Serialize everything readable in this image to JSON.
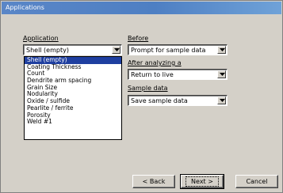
{
  "window": {
    "title": "Applications"
  },
  "application": {
    "label": "Application",
    "selected": "Shell (empty)",
    "options": [
      "Shell (empty)",
      "Coating Thickness",
      "Count",
      "Dendrite arm spacing",
      "Grain Size",
      "Nodularity",
      "Oxide / sulfide",
      "Pearlite / ferrite",
      "Porosity",
      "Weld #1"
    ]
  },
  "before": {
    "label": "Before",
    "value": "Prompt for sample data"
  },
  "after": {
    "label": "After analyzing a",
    "value": "Return to live"
  },
  "sample": {
    "label": "Sample data",
    "value": "Save sample data"
  },
  "buttons": {
    "back": "< Back",
    "next": "Next >",
    "cancel": "Cancel"
  },
  "icons": {
    "dropdown": "chevron-down-icon"
  }
}
